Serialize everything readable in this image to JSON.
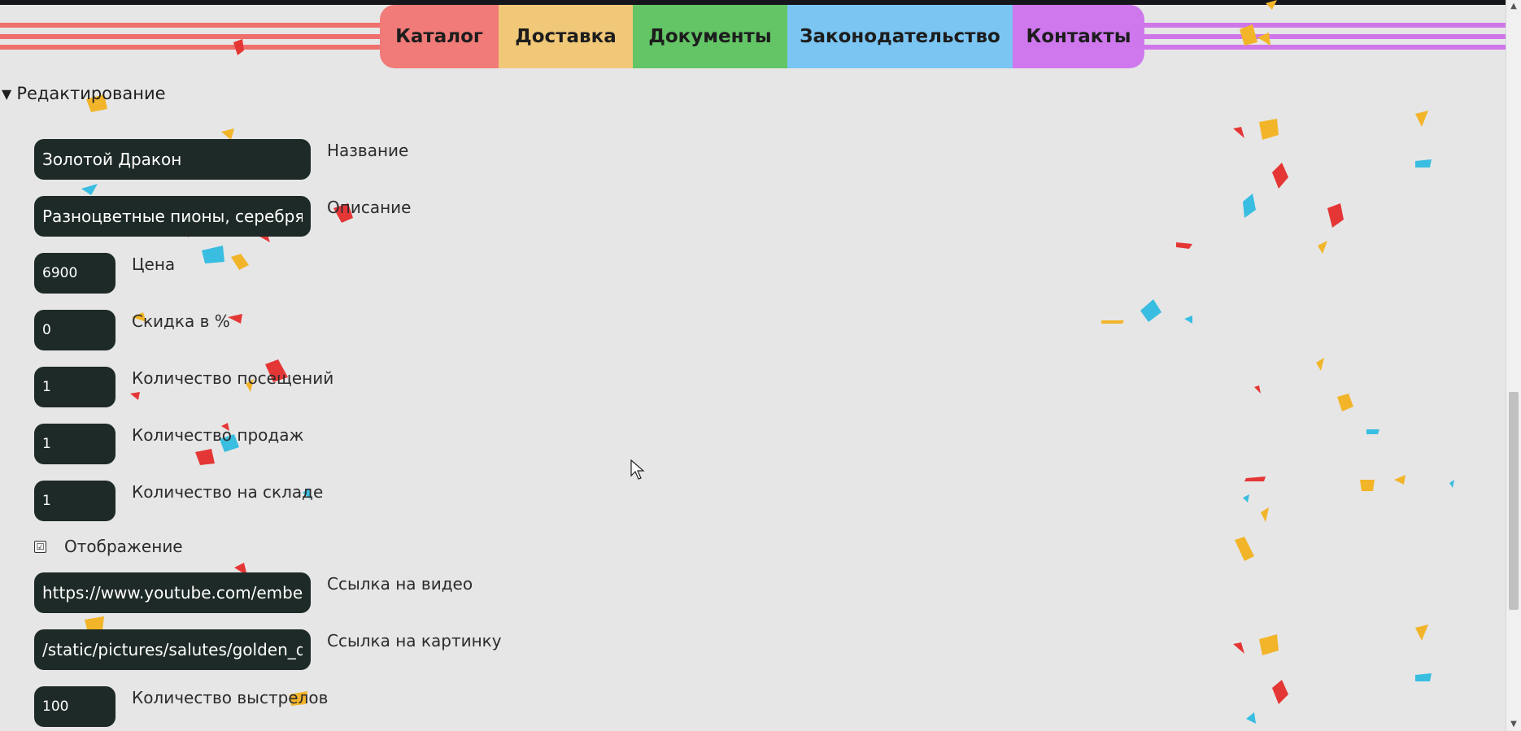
{
  "nav": {
    "items": [
      {
        "label": "Каталог",
        "color": "#f07b78"
      },
      {
        "label": "Доставка",
        "color": "#f1c878"
      },
      {
        "label": "Документы",
        "color": "#63c566"
      },
      {
        "label": "Законодательство",
        "color": "#7ac5f2"
      },
      {
        "label": "Контакты",
        "color": "#cf78ee"
      }
    ]
  },
  "editor": {
    "summary_label": "Редактирование",
    "fields": [
      {
        "value": "Золотой Дракон",
        "label": "Название"
      },
      {
        "value": "Разноцветные пионы, серебряные",
        "label": "Описание"
      },
      {
        "value": "6900",
        "label": "Цена"
      },
      {
        "value": "0",
        "label": "Скидка в %"
      },
      {
        "value": "1",
        "label": "Количество посещений"
      },
      {
        "value": "1",
        "label": "Количество продаж"
      },
      {
        "value": "1",
        "label": "Количество на складе"
      },
      {
        "value": "https://www.youtube.com/embed/",
        "label": "Ссылка на видео"
      },
      {
        "value": "/static/pictures/salutes/golden_dragon",
        "label": "Ссылка на картинку"
      },
      {
        "value": "100",
        "label": "Количество выстрелов"
      }
    ],
    "checkbox": {
      "label": "Отображение",
      "checked": true,
      "mark": "☑"
    }
  },
  "colors": {
    "page_background": "#e6e6e6",
    "input_background": "#1e2a27",
    "confetti_red": "#e53636",
    "confetti_yellow": "#f2b52a",
    "confetti_blue": "#39bde0"
  }
}
